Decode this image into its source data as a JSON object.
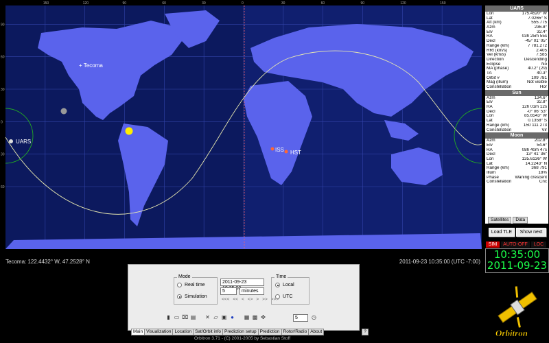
{
  "window": {
    "title": "Orbitron 3.71 - (C) 2001-2005 by Sebastian Stoff"
  },
  "map": {
    "top_ticks": [
      "150",
      "120",
      "90",
      "60",
      "30",
      "0",
      "30",
      "60",
      "90",
      "120",
      "150"
    ],
    "left_ticks": [
      "90",
      "60",
      "30",
      "0",
      "30",
      "60"
    ],
    "labels": {
      "tecoma": "+ Tecoma",
      "uars": "UARS",
      "iss": "ISS",
      "hst": "HST"
    },
    "status_location": "Tecoma: 122.4432° W, 47.2528° N",
    "status_time": "2011-09-23 10:35:00 (UTC -7:00)",
    "colors": {
      "ocean": "#101f6f",
      "land": "#5a63ec",
      "night": "#0a103f",
      "grid": "#3344aa",
      "track": "#e8e8b0"
    }
  },
  "panel": {
    "uars": {
      "title": "UARS",
      "rows": [
        {
          "k": "Lon",
          "v": "175.4520° W"
        },
        {
          "k": "Lat",
          "v": "7.0265° S"
        },
        {
          "k": "Alt (km)",
          "v": "555.775"
        },
        {
          "k": "Azm",
          "v": "236.8°"
        },
        {
          "k": "Elv",
          "v": "32.4°"
        },
        {
          "k": "RA",
          "v": "03h 25m 55s"
        },
        {
          "k": "Decl",
          "v": "-45° 01' 05\""
        },
        {
          "k": "Range (km)",
          "v": "7 781.272"
        },
        {
          "k": "RRt (km/s)",
          "v": "2.405"
        },
        {
          "k": "Vel (km/s)",
          "v": "7.585"
        },
        {
          "k": "Direction",
          "v": "Descending"
        },
        {
          "k": "Eclipse",
          "v": "No"
        },
        {
          "k": "MA (phase)",
          "v": "40.2° (29)"
        },
        {
          "k": "TA",
          "v": "40.3°"
        },
        {
          "k": "Orbit #",
          "v": "109 781"
        },
        {
          "k": "Mag (illum)",
          "v": "Not visible"
        },
        {
          "k": "Constellation",
          "v": "Hor"
        }
      ]
    },
    "sun": {
      "title": "Sun",
      "rows": [
        {
          "k": "Azm",
          "v": "134.6°"
        },
        {
          "k": "Elv",
          "v": "32.8°"
        },
        {
          "k": "RA",
          "v": "12h 01m 12s"
        },
        {
          "k": "Decl",
          "v": "-0° 06' 53\""
        },
        {
          "k": "Lon",
          "v": "85.6543° W"
        },
        {
          "k": "Lat",
          "v": "0.1358° S"
        },
        {
          "k": "Range (km)",
          "v": "150 111 273"
        },
        {
          "k": "Constellation",
          "v": "Vir"
        }
      ]
    },
    "moon": {
      "title": "Moon",
      "rows": [
        {
          "k": "Azm",
          "v": "202.8°"
        },
        {
          "k": "Elv",
          "v": "54.6°"
        },
        {
          "k": "RA",
          "v": "08h 40m 47s"
        },
        {
          "k": "Decl",
          "v": "13° 41' 36\""
        },
        {
          "k": "Lon",
          "v": "135.6136° W"
        },
        {
          "k": "Lat",
          "v": "14.2243° N"
        },
        {
          "k": "Range (km)",
          "v": "368 791"
        },
        {
          "k": "Illum",
          "v": "18%"
        },
        {
          "k": "Phase",
          "v": "Waning crescent"
        },
        {
          "k": "Constellation",
          "v": "Cnc"
        }
      ]
    },
    "tabs": [
      "Satellites",
      "Data"
    ],
    "load_tle": "Load TLE",
    "show_next": "Show next",
    "indicators": [
      "SIM",
      "AUTO-OFF",
      "LOC"
    ],
    "clock_time": "10:35:00",
    "clock_date": "2011-09-23"
  },
  "control": {
    "mode_label": "Mode",
    "real_time": "Real time",
    "simulation": "Simulation",
    "datetime_value": "2011-09-23 10:35:00",
    "step_value": "5",
    "unit_value": "minutes",
    "nav_glyphs": [
      "<<<",
      "<<",
      "<",
      "<>",
      ">",
      ">>",
      ">>>"
    ],
    "time_label": "Time",
    "local": "Local",
    "utc": "UTC",
    "toolbar_step": "5"
  },
  "tabs": [
    "Main",
    "Visualization",
    "Location",
    "Sat/Orbit info",
    "Prediction setup",
    "Prediction",
    "Rotor/Radio",
    "About",
    "?"
  ],
  "logo_text": "Orbitron"
}
